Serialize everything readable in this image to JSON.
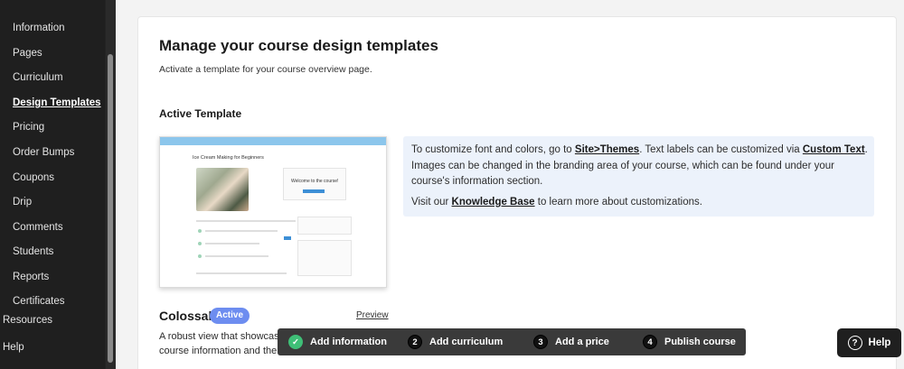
{
  "sidebar": {
    "items": [
      {
        "label": "Information"
      },
      {
        "label": "Pages"
      },
      {
        "label": "Curriculum"
      },
      {
        "label": "Design Templates"
      },
      {
        "label": "Pricing"
      },
      {
        "label": "Order Bumps"
      },
      {
        "label": "Coupons"
      },
      {
        "label": "Drip"
      },
      {
        "label": "Comments"
      },
      {
        "label": "Students"
      },
      {
        "label": "Reports"
      },
      {
        "label": "Certificates"
      }
    ],
    "active": "Design Templates",
    "outer_items": [
      {
        "label": "Resources"
      },
      {
        "label": "Help"
      }
    ]
  },
  "main": {
    "title": "Manage your course design templates",
    "subtitle": "Activate a template for your course overview page.",
    "section_title": "Active Template",
    "thumbnail": {
      "course_title": "Ice Cream Making for Beginners",
      "welcome": "Welcome to the course!"
    },
    "info": {
      "p1_a": "To customize font and colors, go to ",
      "p1_link1": "Site>Themes",
      "p1_b": ". Text labels can be customized via ",
      "p1_link2": "Custom Text",
      "p1_c": ". Images can be changed in the branding area of your course, which can be found under your course's information section.",
      "p2_a": "Visit our ",
      "p2_link": "Knowledge Base",
      "p2_b": " to learn more about customizations."
    },
    "template": {
      "name": "Colossal",
      "badge": "Active",
      "preview_label": "Preview",
      "desc_line1": "A robust view that showcas",
      "desc_line2": "course information and the"
    }
  },
  "stepper": {
    "steps": [
      {
        "num": "✓",
        "label": "Add information",
        "done": true
      },
      {
        "num": "2",
        "label": "Add curriculum",
        "done": false
      },
      {
        "num": "3",
        "label": "Add a price",
        "done": false
      },
      {
        "num": "4",
        "label": "Publish course",
        "done": false
      }
    ]
  },
  "help": {
    "label": "Help",
    "icon": "question-circle-icon"
  },
  "colors": {
    "sidebar_bg": "#1f1f1f",
    "badge": "#6d8df0",
    "info_bg": "#ecf2fb",
    "step_done": "#3fbf77",
    "stepper_bg": "#3a3a3a"
  }
}
